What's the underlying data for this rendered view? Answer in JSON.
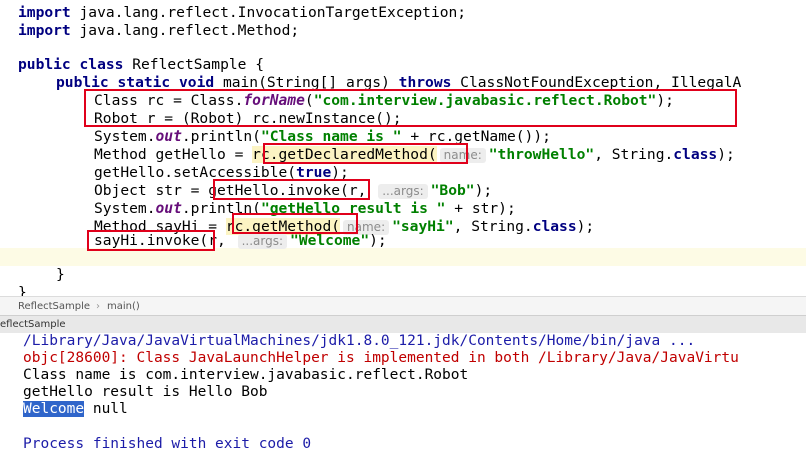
{
  "editor": {
    "lines": {
      "l1_kw": "import",
      "l1_rest": " java.lang.reflect.InvocationTargetException;",
      "l2_kw": "import",
      "l2_rest": " java.lang.reflect.Method;",
      "l4_kw": "public class",
      "l4_rest": " ReflectSample {",
      "l5_kw1": "public static void",
      "l5_mid": " main(String[] args) ",
      "l5_kw2": "throws",
      "l5_rest": " ClassNotFoundException, IllegalA",
      "l6_a": "Class rc = Class.",
      "l6_it": "forName",
      "l6_b": "(",
      "l6_str": "\"com.interview.javabasic.reflect.Robot\"",
      "l6_c": ");",
      "l7": "Robot r = (Robot) rc.newInstance();",
      "l8_a": "System.",
      "l8_it": "out",
      "l8_b": ".println(",
      "l8_str": "\"Class name is \"",
      "l8_c": " + rc.getName());",
      "l9_a": "Method getHello = ",
      "l9_hl": "rc.getDeclaredMethod(",
      "l9_hint": "name:",
      "l9_str": "\"throwHello\"",
      "l9_b": ", String.",
      "l9_kw": "class",
      "l9_c": ");",
      "l10_a": "getHello.setAccessible(",
      "l10_kw": "true",
      "l10_b": ");",
      "l11_a": "Object str = ",
      "l11_hl": "getHello.invoke(",
      "l11_b": "r, ",
      "l11_hint": "...args:",
      "l11_str": "\"Bob\"",
      "l11_c": ");",
      "l12_a": "System.",
      "l12_it": "out",
      "l12_b": ".println(",
      "l12_str": "\"getHello result is \"",
      "l12_c": " + str);",
      "l13_a": "Method sayHi = ",
      "l13_hl": "rc.getMethod(",
      "l13_hint": "name:",
      "l13_str": "\"sayHi\"",
      "l13_b": ", String.",
      "l13_kw": "class",
      "l13_c": ");",
      "l14_hl": "sayHi.invoke(",
      "l14_a": "r, ",
      "l14_hint": "...args:",
      "l14_str": "\"Welcome\"",
      "l14_b": ");",
      "l16": "}",
      "l17": "}"
    }
  },
  "breadcrumb": {
    "class": "ReflectSample",
    "sep": "›",
    "method": "main()"
  },
  "run_tab": {
    "label": "eflectSample"
  },
  "console": {
    "line1": "/Library/Java/JavaVirtualMachines/jdk1.8.0_121.jdk/Contents/Home/bin/java ...",
    "line2": "objc[28600]: Class JavaLaunchHelper is implemented in both /Library/Java/JavaVirtu",
    "line3": "Class name is com.interview.javabasic.reflect.Robot",
    "line4": "getHello result is Hello Bob",
    "line5_sel": "Welcome",
    "line5_rest": " null",
    "line6": "Process finished with exit code 0"
  },
  "colors": {
    "keyword": "#000080",
    "string": "#008000",
    "highlight_box": "#e0001b",
    "console_blue": "#1c1ca8",
    "console_red": "#c00000",
    "selection": "#2f65ca"
  }
}
